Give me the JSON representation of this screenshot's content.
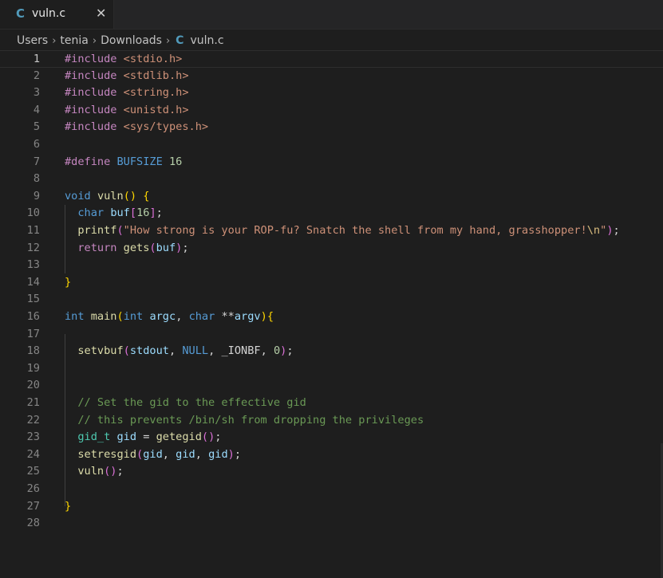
{
  "tab": {
    "lang_glyph": "C",
    "filename": "vuln.c",
    "close_glyph": "✕"
  },
  "breadcrumb": {
    "items": [
      "Users",
      "tenia",
      "Downloads"
    ],
    "separator": "›",
    "lang_glyph": "C",
    "file": "vuln.c"
  },
  "editor": {
    "current_line": 1,
    "lines": [
      [
        [
          "pp",
          "#include "
        ],
        [
          "str",
          "<stdio.h>"
        ]
      ],
      [
        [
          "pp",
          "#include "
        ],
        [
          "str",
          "<stdlib.h>"
        ]
      ],
      [
        [
          "pp",
          "#include "
        ],
        [
          "str",
          "<string.h>"
        ]
      ],
      [
        [
          "pp",
          "#include "
        ],
        [
          "str",
          "<unistd.h>"
        ]
      ],
      [
        [
          "pp",
          "#include "
        ],
        [
          "str",
          "<sys/types.h>"
        ]
      ],
      [],
      [
        [
          "pp",
          "#define "
        ],
        [
          "macro",
          "BUFSIZE"
        ],
        [
          "txt",
          " "
        ],
        [
          "num",
          "16"
        ]
      ],
      [],
      [
        [
          "kw",
          "void"
        ],
        [
          "txt",
          " "
        ],
        [
          "fn",
          "vuln"
        ],
        [
          "br1",
          "()"
        ],
        [
          "txt",
          " "
        ],
        [
          "br1",
          "{"
        ]
      ],
      [
        [
          "txt",
          "  "
        ],
        [
          "kw",
          "char"
        ],
        [
          "txt",
          " "
        ],
        [
          "var",
          "buf"
        ],
        [
          "br2",
          "["
        ],
        [
          "num",
          "16"
        ],
        [
          "br2",
          "]"
        ],
        [
          "txt",
          ";"
        ]
      ],
      [
        [
          "txt",
          "  "
        ],
        [
          "fn",
          "printf"
        ],
        [
          "br2",
          "("
        ],
        [
          "str",
          "\"How strong is your ROP-fu? Snatch the shell from my hand, grasshopper!"
        ],
        [
          "esc",
          "\\n"
        ],
        [
          "str",
          "\""
        ],
        [
          "br2",
          ")"
        ],
        [
          "txt",
          ";"
        ]
      ],
      [
        [
          "txt",
          "  "
        ],
        [
          "ctl",
          "return"
        ],
        [
          "txt",
          " "
        ],
        [
          "fn",
          "gets"
        ],
        [
          "br2",
          "("
        ],
        [
          "var",
          "buf"
        ],
        [
          "br2",
          ")"
        ],
        [
          "txt",
          ";"
        ]
      ],
      [],
      [
        [
          "br1",
          "}"
        ]
      ],
      [],
      [
        [
          "kw",
          "int"
        ],
        [
          "txt",
          " "
        ],
        [
          "fn",
          "main"
        ],
        [
          "br1",
          "("
        ],
        [
          "kw",
          "int"
        ],
        [
          "txt",
          " "
        ],
        [
          "var",
          "argc"
        ],
        [
          "txt",
          ", "
        ],
        [
          "kw",
          "char"
        ],
        [
          "txt",
          " **"
        ],
        [
          "var",
          "argv"
        ],
        [
          "br1",
          ")"
        ],
        [
          "br1",
          "{"
        ]
      ],
      [],
      [
        [
          "txt",
          "  "
        ],
        [
          "fn",
          "setvbuf"
        ],
        [
          "br2",
          "("
        ],
        [
          "var",
          "stdout"
        ],
        [
          "txt",
          ", "
        ],
        [
          "macro",
          "NULL"
        ],
        [
          "txt",
          ", "
        ],
        [
          "txt",
          "_IONBF"
        ],
        [
          "txt",
          ", "
        ],
        [
          "num",
          "0"
        ],
        [
          "br2",
          ")"
        ],
        [
          "txt",
          ";"
        ]
      ],
      [],
      [],
      [
        [
          "txt",
          "  "
        ],
        [
          "cm",
          "// Set the gid to the effective gid"
        ]
      ],
      [
        [
          "txt",
          "  "
        ],
        [
          "cm",
          "// this prevents /bin/sh from dropping the privileges"
        ]
      ],
      [
        [
          "txt",
          "  "
        ],
        [
          "type",
          "gid_t"
        ],
        [
          "txt",
          " "
        ],
        [
          "var",
          "gid"
        ],
        [
          "txt",
          " = "
        ],
        [
          "fn",
          "getegid"
        ],
        [
          "br2",
          "()"
        ],
        [
          "txt",
          ";"
        ]
      ],
      [
        [
          "txt",
          "  "
        ],
        [
          "fn",
          "setresgid"
        ],
        [
          "br2",
          "("
        ],
        [
          "var",
          "gid"
        ],
        [
          "txt",
          ", "
        ],
        [
          "var",
          "gid"
        ],
        [
          "txt",
          ", "
        ],
        [
          "var",
          "gid"
        ],
        [
          "br2",
          ")"
        ],
        [
          "txt",
          ";"
        ]
      ],
      [
        [
          "txt",
          "  "
        ],
        [
          "fn",
          "vuln"
        ],
        [
          "br2",
          "()"
        ],
        [
          "txt",
          ";"
        ]
      ],
      [],
      [
        [
          "br1",
          "}"
        ]
      ],
      []
    ]
  }
}
